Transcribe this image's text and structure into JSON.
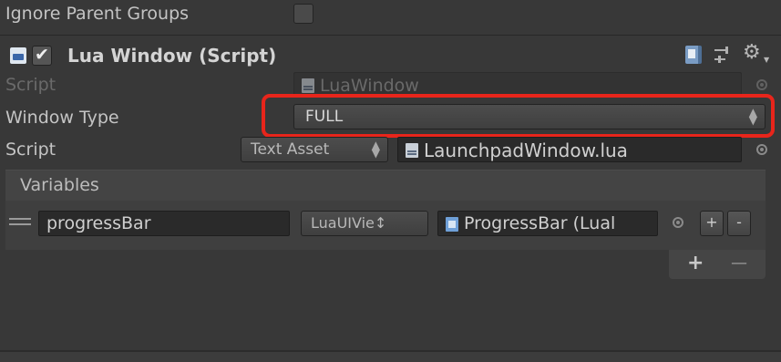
{
  "ignore_parent_groups": {
    "label": "Ignore Parent Groups",
    "checked": false
  },
  "component": {
    "title": "Lua Window (Script)",
    "enabled": true,
    "icons": [
      "cs-script-icon",
      "checkbox-icon",
      "help-book-icon",
      "sliders-icon",
      "gear-icon"
    ]
  },
  "script_row": {
    "label": "Script",
    "value": "LuaWindow"
  },
  "window_type": {
    "label": "Window Type",
    "value": "FULL"
  },
  "lua_script": {
    "label": "Script",
    "type_value": "Text Asset",
    "file_value": "LaunchpadWindow.lua"
  },
  "variables": {
    "header": "Variables",
    "rows": [
      {
        "name": "progressBar",
        "type": "LuaUIVie↕",
        "value": "ProgressBar (Lual"
      }
    ],
    "add_label": "+",
    "remove_label": "-",
    "list_add_label": "+",
    "list_remove_label": "—"
  }
}
